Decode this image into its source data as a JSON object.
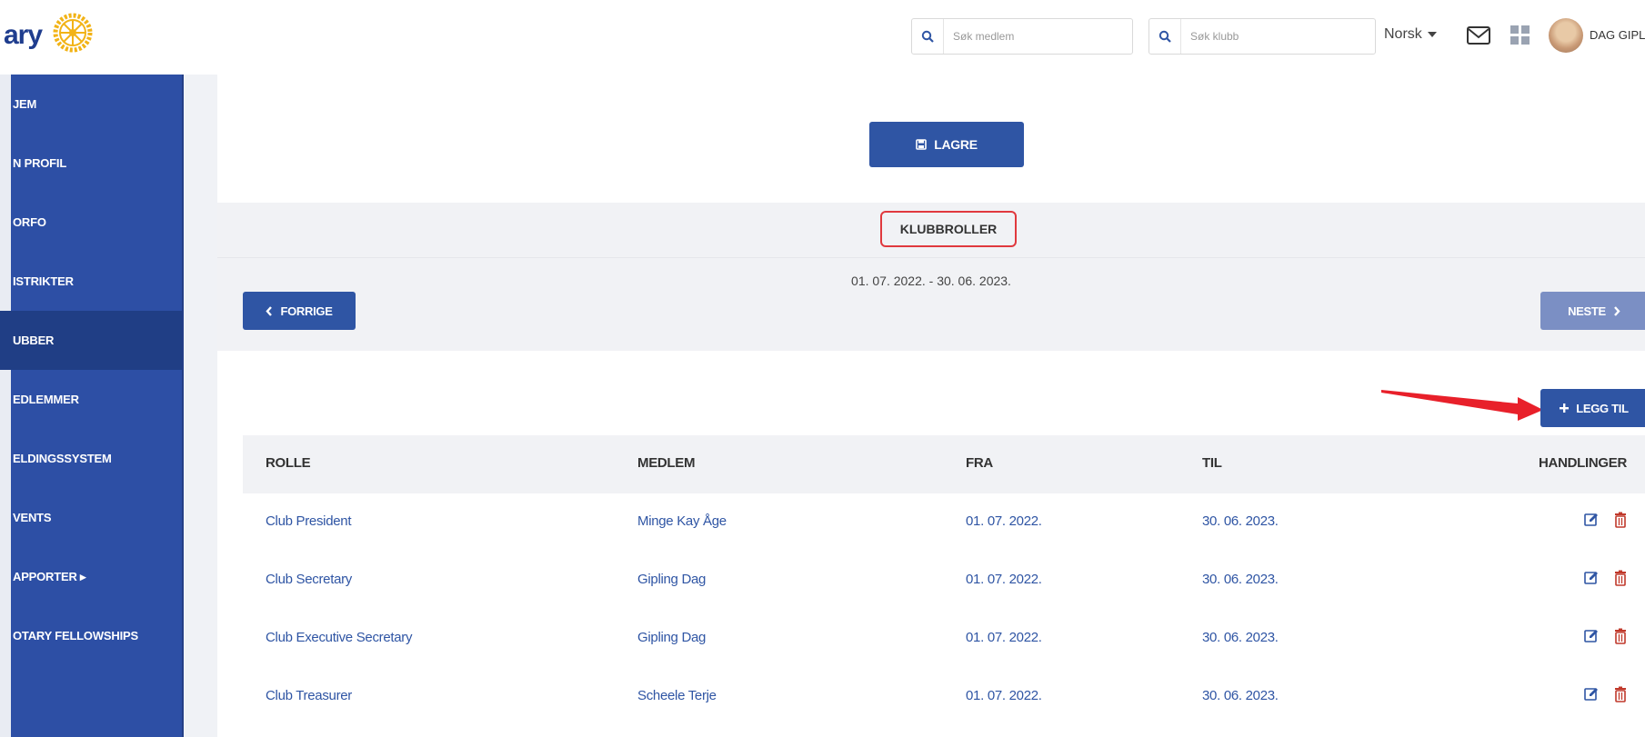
{
  "header": {
    "logo_text": "ary",
    "search_member_placeholder": "Søk medlem",
    "search_club_placeholder": "Søk klubb",
    "language": "Norsk",
    "user_name": "DAG GIPL"
  },
  "sidebar": {
    "items": [
      {
        "label": "JEM"
      },
      {
        "label": "N PROFIL"
      },
      {
        "label": "ORFO"
      },
      {
        "label": "ISTRIKTER"
      },
      {
        "label": "UBBER"
      },
      {
        "label": "EDLEMMER"
      },
      {
        "label": "ELDINGSSYSTEM"
      },
      {
        "label": "VENTS"
      },
      {
        "label": "APPORTER ▸"
      },
      {
        "label": "OTARY FELLOWSHIPS"
      }
    ]
  },
  "main": {
    "save_label": "LAGRE",
    "section_title": "KLUBBROLLER",
    "period": "01. 07. 2022. - 30. 06. 2023.",
    "prev_label": "FORRIGE",
    "next_label": "NESTE",
    "add_label": "LEGG TIL"
  },
  "table": {
    "columns": [
      "ROLLE",
      "MEDLEM",
      "FRA",
      "TIL",
      "HANDLINGER"
    ],
    "rows": [
      {
        "rolle": "Club President",
        "medlem": "Minge Kay Åge",
        "fra": "01. 07. 2022.",
        "til": "30. 06. 2023."
      },
      {
        "rolle": "Club Secretary",
        "medlem": "Gipling Dag",
        "fra": "01. 07. 2022.",
        "til": "30. 06. 2023."
      },
      {
        "rolle": "Club Executive Secretary",
        "medlem": "Gipling Dag",
        "fra": "01. 07. 2022.",
        "til": "30. 06. 2023."
      },
      {
        "rolle": "Club Treasurer",
        "medlem": "Scheele Terje",
        "fra": "01. 07. 2022.",
        "til": "30. 06. 2023."
      }
    ]
  },
  "colors": {
    "brand_blue": "#2f55a4",
    "sidebar_blue": "#2d4fa5",
    "highlight_red": "#e0393e",
    "delete_red": "#c0392b"
  },
  "icons": [
    "search-icon",
    "mail-icon",
    "apps-grid-icon",
    "caret-down-icon",
    "save-icon",
    "chevron-left-icon",
    "chevron-right-icon",
    "plus-icon",
    "edit-icon",
    "trash-icon"
  ]
}
